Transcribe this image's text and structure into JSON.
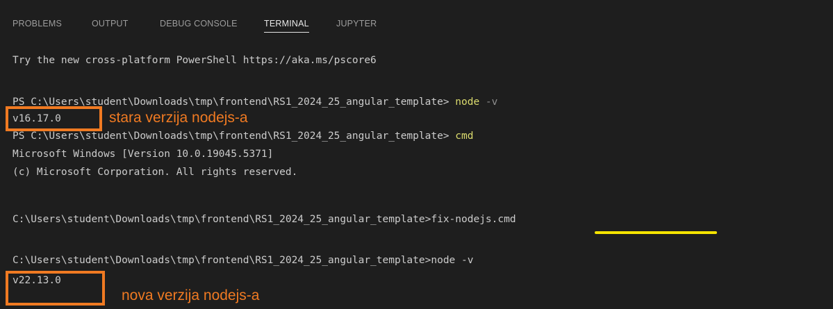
{
  "panel": {
    "tabs": [
      {
        "label": "PROBLEMS",
        "active": false
      },
      {
        "label": "OUTPUT",
        "active": false
      },
      {
        "label": "DEBUG CONSOLE",
        "active": false
      },
      {
        "label": "TERMINAL",
        "active": true
      },
      {
        "label": "JUPYTER",
        "active": false
      }
    ]
  },
  "terminal": {
    "line1": "Try the new cross-platform PowerShell https://aka.ms/pscore6",
    "prompt_ps": "PS C:\\Users\\student\\Downloads\\tmp\\frontend\\RS1_2024_25_angular_template> ",
    "cmd_node": "node",
    "flag_v": " -v",
    "version_old": "v16.17.0",
    "cmd_cmd": "cmd",
    "win_version": "Microsoft Windows [Version 10.0.19045.5371]",
    "copyright": "(c) Microsoft Corporation. All rights reserved.",
    "prompt_cmd": "C:\\Users\\student\\Downloads\\tmp\\frontend\\RS1_2024_25_angular_template>",
    "cmd_fix": "fix-nodejs.cmd",
    "cmd_node_v": "node -v",
    "version_new": "v22.13.0"
  },
  "annotations": {
    "old_note": "stara verzija nodejs-a",
    "new_note": "nova verzija nodejs-a",
    "highlight_color": "#f07a22",
    "underline_color": "#f5e400"
  }
}
